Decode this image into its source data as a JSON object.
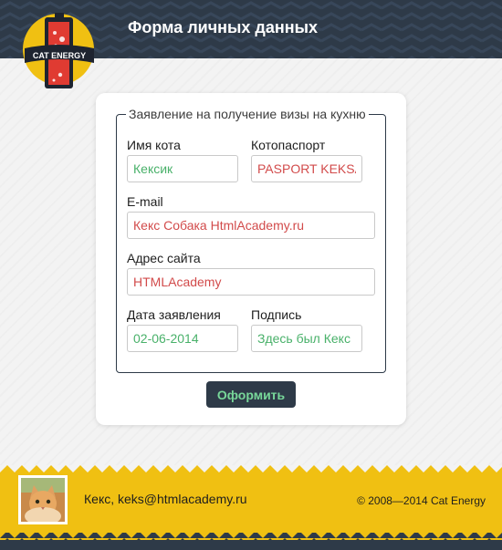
{
  "header": {
    "title": "Форма личных данных",
    "logo_text": "CAT ENERGY",
    "logo_icon": "cat-energy-battery-logo"
  },
  "form": {
    "legend": "Заявление на получение визы на кухню",
    "fields": {
      "cat_name": {
        "label": "Имя кота",
        "value": "Кексик",
        "status": "valid"
      },
      "passport": {
        "label": "Котопаспорт",
        "value": "PASPORT KEKSA",
        "status": "invalid"
      },
      "email": {
        "label": "E-mail",
        "value": "Кекс Собака HtmlAcademy.ru",
        "status": "invalid"
      },
      "website": {
        "label": "Адрес сайта",
        "value": "HTMLAcademy",
        "status": "invalid"
      },
      "date": {
        "label": "Дата заявления",
        "value": "02-06-2014",
        "status": "valid"
      },
      "signature": {
        "label": "Подпись",
        "value": "Здесь был Кекс",
        "status": "valid"
      }
    },
    "submit_label": "Оформить"
  },
  "footer": {
    "contact": "Кекс, keks@htmlacademy.ru",
    "copyright": "© 2008—2014 Cat Energy",
    "avatar_icon": "cat-avatar"
  },
  "colors": {
    "header_bg": "#2e3a48",
    "accent_yellow": "#f0c012",
    "valid_text": "#49b16a",
    "invalid_text": "#d24b4b",
    "button_text": "#78d89a"
  }
}
